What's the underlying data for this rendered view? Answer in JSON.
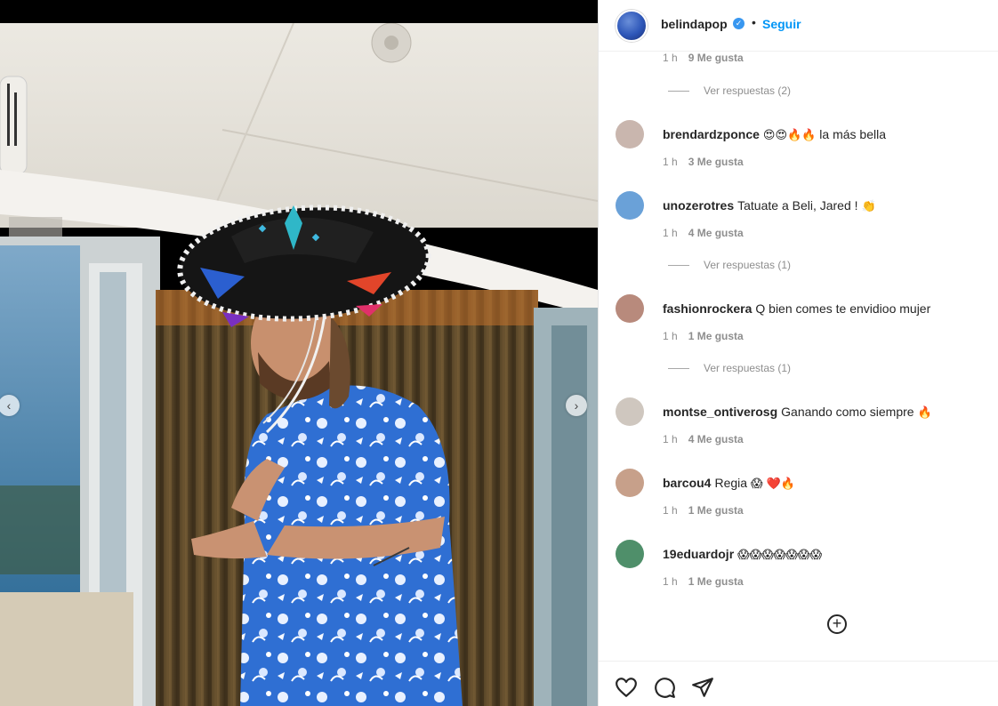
{
  "post": {
    "username": "belindapop",
    "follow_label": "Seguir",
    "separator": "•",
    "verified_glyph": "✓"
  },
  "carousel": {
    "prev_glyph": "‹",
    "next_glyph": "›"
  },
  "comments": {
    "first_meta": {
      "time": "1 h",
      "likes": "9 Me gusta"
    },
    "first_replies": "Ver respuestas (2)",
    "items": [
      {
        "user": "brendardzponce",
        "text": " la más bella",
        "emoji": "😍😍🔥🔥",
        "time": "1 h",
        "likes": "3 Me gusta",
        "avatar_color": "#c9b6ae"
      },
      {
        "user": "unozerotres",
        "text": "Tatuate a Beli, Jared ! ",
        "emoji": "👏",
        "time": "1 h",
        "likes": "4 Me gusta",
        "replies": "Ver respuestas (1)",
        "avatar_color": "#6aa1d8"
      },
      {
        "user": "fashionrockera",
        "text": "Q bien comes te envidioo mujer",
        "emoji": "",
        "time": "1 h",
        "likes": "1 Me gusta",
        "replies": "Ver respuestas (1)",
        "avatar_color": "#b88a7c"
      },
      {
        "user": "montse_ontiverosg",
        "text": "Ganando como siempre ",
        "emoji": "🔥",
        "time": "1 h",
        "likes": "4 Me gusta",
        "avatar_color": "#cfc7bf"
      },
      {
        "user": "barcou4",
        "text": "Regia ",
        "emoji": "😱 ❤️🔥",
        "time": "1 h",
        "likes": "1 Me gusta",
        "avatar_color": "#c7a08a"
      },
      {
        "user": "19eduardojr",
        "text": "",
        "emoji": "😱😱😱😱😱😱😱",
        "time": "1 h",
        "likes": "1 Me gusta",
        "avatar_color": "#4f8f6a"
      }
    ]
  },
  "add_more_glyph": "+",
  "colors": {
    "link": "#0095f6",
    "text": "#262626",
    "muted": "#8e8e8e",
    "verified": "#3897f0"
  },
  "icons": [
    "heart-icon",
    "comment-icon",
    "share-icon",
    "plus-circle-icon",
    "verified-icon"
  ]
}
